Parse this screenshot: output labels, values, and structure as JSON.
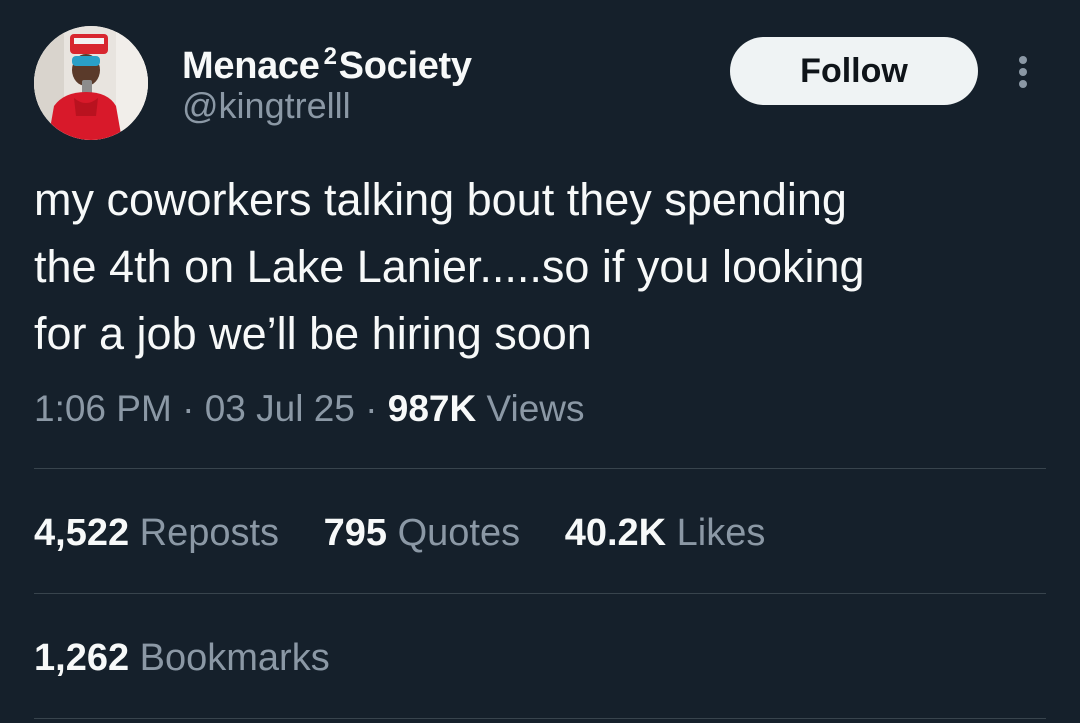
{
  "user": {
    "display_name_part1": "Menace",
    "display_name_sup": "2",
    "display_name_part2": "Society",
    "handle": "@kingtrelll"
  },
  "follow_button": {
    "label": "Follow"
  },
  "more_menu": {
    "icon": "more-vertical-icon"
  },
  "tweet": {
    "lines": [
      "my coworkers talking bout they spending",
      "the 4th on Lake Lanier.....so if you looking",
      "for a job we’ll be hiring soon"
    ]
  },
  "meta": {
    "time": "1:06 PM",
    "separator": "·",
    "date": "03 Jul 25",
    "views_count": "987K",
    "views_label": "Views"
  },
  "stats": {
    "reposts_count": "4,522",
    "reposts_label": "Reposts",
    "quotes_count": "795",
    "quotes_label": "Quotes",
    "likes_count": "40.2K",
    "likes_label": "Likes",
    "bookmarks_count": "1,262",
    "bookmarks_label": "Bookmarks"
  },
  "colors": {
    "background": "#15202b",
    "primary_text": "#f7f9f9",
    "secondary_text": "#8b98a5",
    "divider": "#38444d",
    "follow_bg": "#eff3f4"
  }
}
